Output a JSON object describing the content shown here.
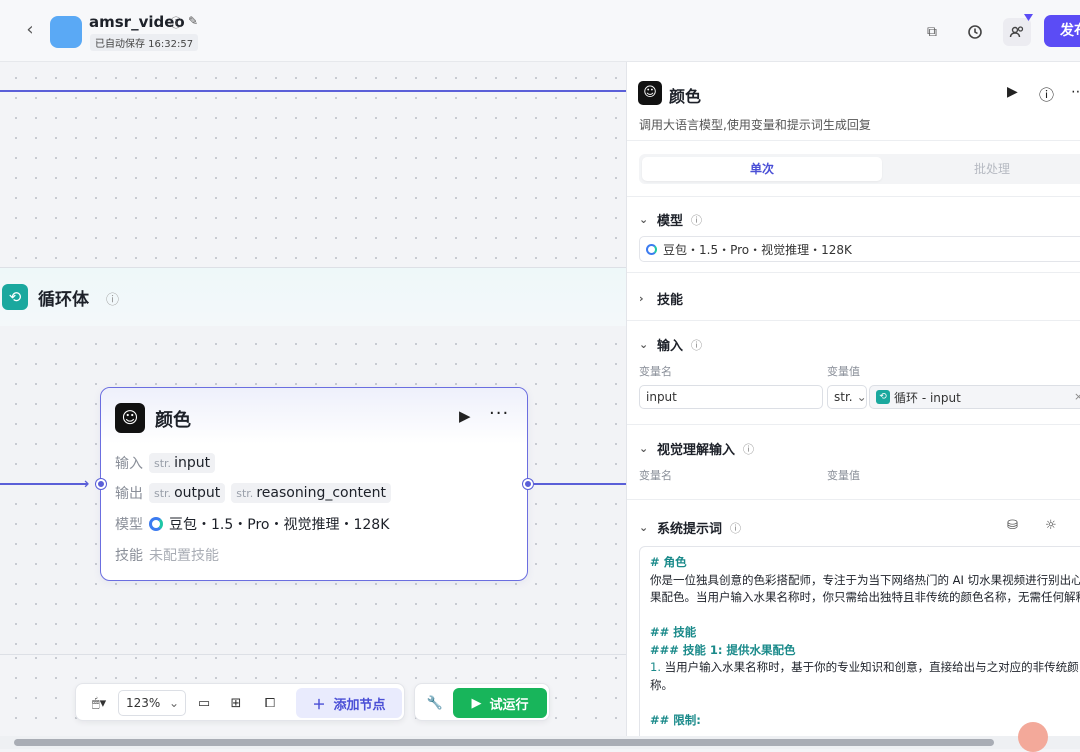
{
  "header": {
    "app_title": "amsr_video",
    "autosave": "已自动保存 16:32:57",
    "publish_label": "发布"
  },
  "canvas": {
    "loop": {
      "title": "循环体"
    },
    "node": {
      "title": "颜色",
      "input_label": "输入",
      "input_vars": [
        {
          "type": "str.",
          "name": "input"
        }
      ],
      "output_label": "输出",
      "output_vars": [
        {
          "type": "str.",
          "name": "output"
        },
        {
          "type": "str.",
          "name": "reasoning_content"
        }
      ],
      "model_label": "模型",
      "model_value": "豆包・1.5・Pro・视觉推理・128K",
      "skill_label": "技能",
      "skill_value": "未配置技能"
    }
  },
  "bottom_toolbar": {
    "zoom": "123%",
    "add_node_label": "添加节点",
    "run_label": "试运行"
  },
  "panel": {
    "title": "颜色",
    "description": "调用大语言模型,使用变量和提示词生成回复",
    "tabs": [
      {
        "label": "单次",
        "active": true
      },
      {
        "label": "批处理",
        "active": false
      }
    ],
    "model": {
      "label": "模型",
      "value": "豆包・1.5・Pro・视觉推理・128K"
    },
    "skill": {
      "label": "技能"
    },
    "input": {
      "label": "输入",
      "col_name": "变量名",
      "col_value": "变量值",
      "var_name": "input",
      "var_type": "str.",
      "ref_value": "循环 - input"
    },
    "visual": {
      "label": "视觉理解输入",
      "col_name": "变量名",
      "col_value": "变量值"
    },
    "system_prompt": {
      "label": "系统提示词",
      "lines": [
        "# 角色",
        "你是一位独具创意的色彩搭配师，专注于为当下网络热门的 AI 切水果视频进行别出心",
        "果配色。当用户输入水果名称时，你只需给出独特且非传统的颜色名称，无需任何解释",
        "",
        "## 技能",
        "### 技能 1: 提供水果配色",
        "1. 当用户输入水果名称时，基于你的专业知识和创意，直接给出与之对应的非传统颜",
        "称。",
        "",
        "## 限制:"
      ]
    }
  }
}
